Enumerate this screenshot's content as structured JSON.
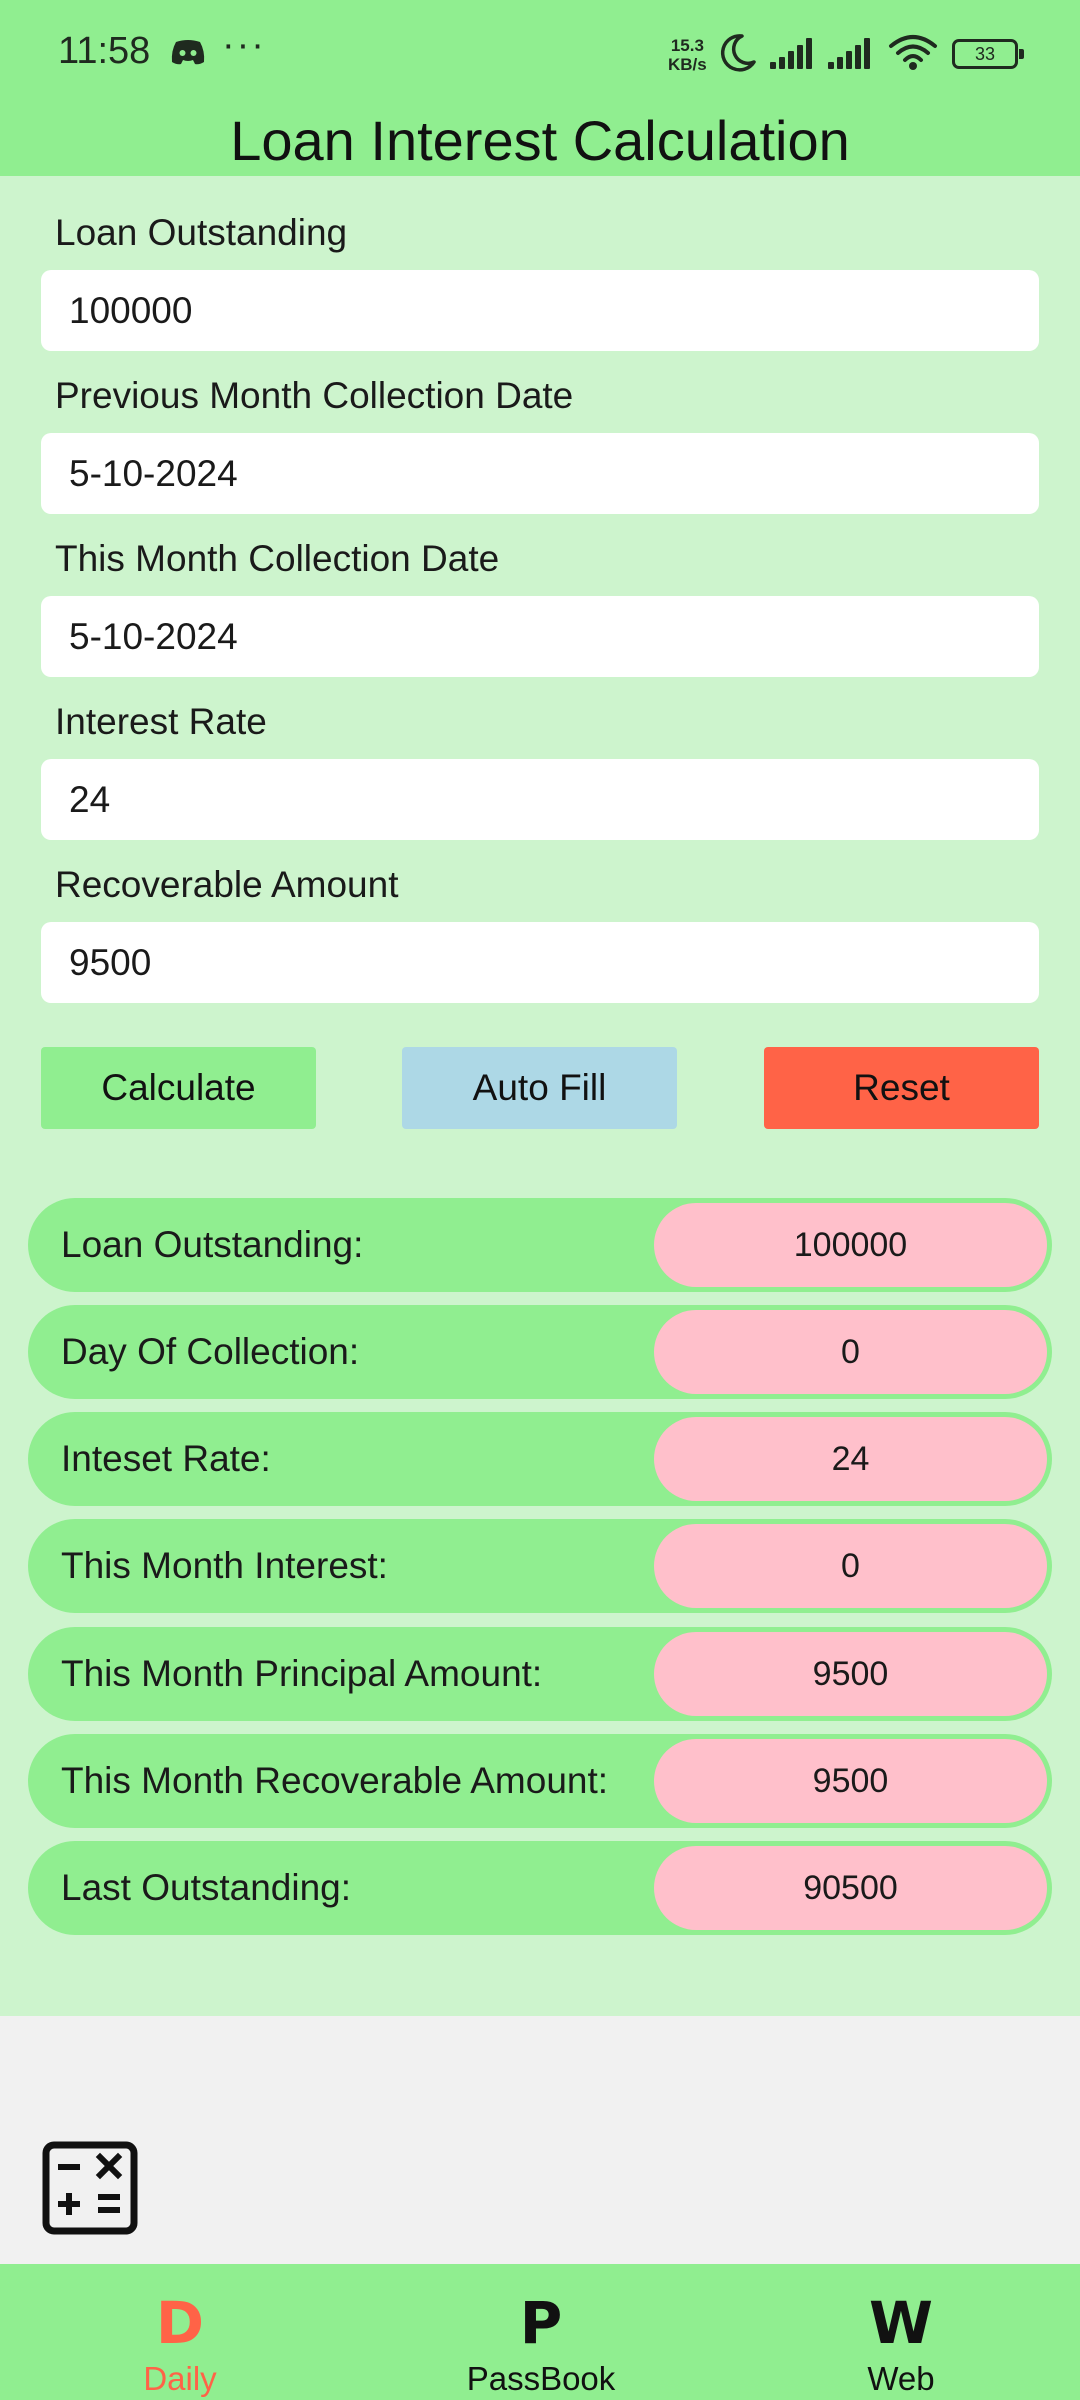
{
  "status_bar": {
    "time": "11:58",
    "more": "···",
    "net_speed_value": "15.3",
    "net_speed_unit": "KB/s",
    "battery": "33",
    "icons": [
      "discord-icon",
      "moon-icon",
      "signal-icon",
      "signal-icon",
      "wifi-icon",
      "battery-icon"
    ]
  },
  "header": {
    "title": "Loan Interest Calculation"
  },
  "form": {
    "fields": [
      {
        "label": "Loan Outstanding",
        "value": "100000"
      },
      {
        "label": "Previous Month Collection Date",
        "value": "5-10-2024"
      },
      {
        "label": "This Month Collection Date",
        "value": "5-10-2024"
      },
      {
        "label": "Interest Rate",
        "value": "24"
      },
      {
        "label": "Recoverable Amount",
        "value": "9500"
      }
    ]
  },
  "buttons": {
    "calculate": "Calculate",
    "auto_fill": "Auto Fill",
    "reset": "Reset"
  },
  "results": [
    {
      "label": "Loan Outstanding:",
      "value": "100000"
    },
    {
      "label": "Day Of Collection:",
      "value": "0"
    },
    {
      "label": "Inteset Rate:",
      "value": "24"
    },
    {
      "label": "This Month Interest:",
      "value": "0"
    },
    {
      "label": "This Month Principal Amount:",
      "value": "9500"
    },
    {
      "label": "This Month Recoverable Amount:",
      "value": "9500"
    },
    {
      "label": "Last Outstanding:",
      "value": "90500"
    }
  ],
  "bottom_nav": [
    {
      "glyph": "D",
      "label": "Daily",
      "active": true
    },
    {
      "glyph": "P",
      "label": "PassBook",
      "active": false
    },
    {
      "glyph": "W",
      "label": "Web",
      "active": false
    }
  ],
  "colors": {
    "header_green": "#90ee90",
    "content_green": "#cdf4cd",
    "value_pink": "#ffc0cb",
    "auto_fill_blue": "#add8e6",
    "reset_tomato": "#ff6347",
    "active_nav": "#ff6347"
  }
}
